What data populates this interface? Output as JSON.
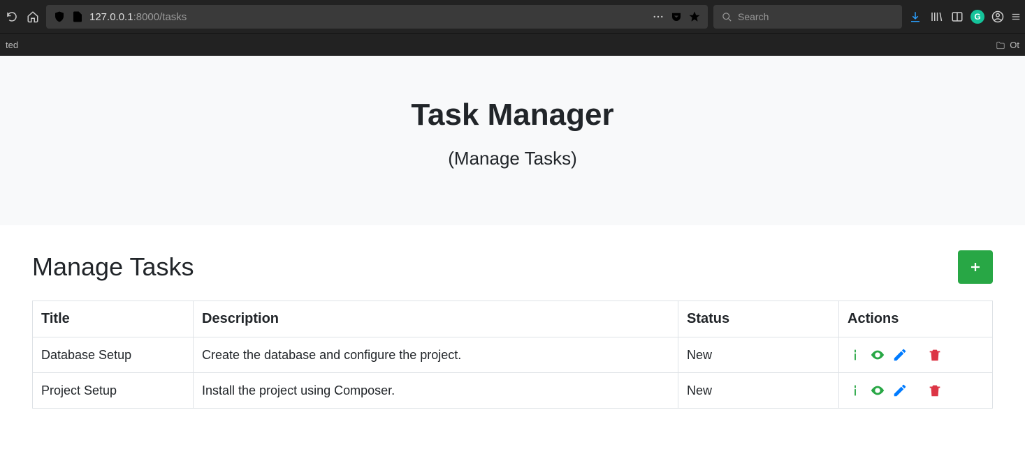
{
  "browser": {
    "url_host": "127.0.0.1",
    "url_port": ":8000",
    "url_path": "/tasks",
    "search_placeholder": "Search",
    "bookmarks_left": "ted",
    "bookmarks_right": "Ot"
  },
  "hero": {
    "title": "Task Manager",
    "subtitle": "(Manage Tasks)"
  },
  "section": {
    "heading": "Manage Tasks"
  },
  "table": {
    "headers": {
      "title": "Title",
      "description": "Description",
      "status": "Status",
      "actions": "Actions"
    },
    "rows": [
      {
        "title": "Database Setup",
        "description": "Create the database and configure the project.",
        "status": "New"
      },
      {
        "title": "Project Setup",
        "description": "Install the project using Composer.",
        "status": "New"
      }
    ]
  }
}
